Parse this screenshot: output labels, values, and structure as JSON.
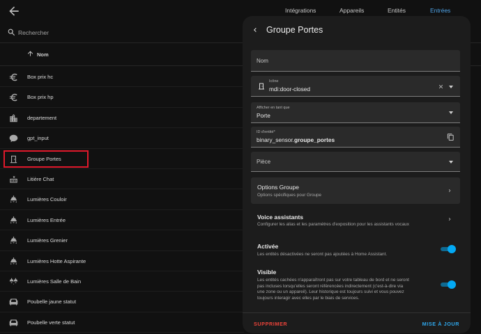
{
  "topbar": {
    "tabs": [
      {
        "label": "Intégrations"
      },
      {
        "label": "Appareils"
      },
      {
        "label": "Entités"
      },
      {
        "label": "Entrées",
        "active": true
      }
    ]
  },
  "search": {
    "placeholder": "Rechercher"
  },
  "table": {
    "column_header": "Nom",
    "rows": [
      {
        "label": "Box prix hc",
        "icon": "euro-icon"
      },
      {
        "label": "Box prix hp",
        "icon": "euro-icon"
      },
      {
        "label": "departement",
        "icon": "city-icon"
      },
      {
        "label": "gpt_input",
        "icon": "chat-bubble-icon"
      },
      {
        "label": "Groupe Portes",
        "icon": "door-closed-icon",
        "highlighted": true
      },
      {
        "label": "Litière Chat",
        "icon": "cat-litter-icon"
      },
      {
        "label": "Lumières Couloir",
        "icon": "ceiling-light-icon"
      },
      {
        "label": "Lumières Entrée",
        "icon": "ceiling-light-icon"
      },
      {
        "label": "Lumières Grenier",
        "icon": "ceiling-light-icon"
      },
      {
        "label": "Lumières Hotte Aspirante",
        "icon": "ceiling-light-icon"
      },
      {
        "label": "Lumières Salle de Bain",
        "icon": "ceiling-light-multiple-icon"
      },
      {
        "label": "Poubelle jaune statut",
        "icon": "sofa-icon"
      },
      {
        "label": "Poubelle verte statut",
        "icon": "sofa-icon"
      }
    ]
  },
  "dialog": {
    "title": "Groupe Portes",
    "name_field": {
      "label": "Nom",
      "value": ""
    },
    "icon_field": {
      "label": "Icône",
      "value": "mdi:door-closed"
    },
    "show_as_field": {
      "label": "Afficher en tant que",
      "value": "Porte"
    },
    "entity_id_field": {
      "label": "ID d'entité*",
      "prefix": "binary_sensor.",
      "suffix": "groupe_portes"
    },
    "room_field": {
      "label": "Pièce"
    },
    "group_options": {
      "title": "Options Groupe",
      "subtitle": "Options spécifiques pour Groupe"
    },
    "voice": {
      "title": "Voice assistants",
      "subtitle": "Configurer les alias et les paramètres d'exposition pour les assistants vocaux"
    },
    "enabled": {
      "title": "Activée",
      "description": "Les entités désactivées ne seront pas ajoutées à Home Assistant.",
      "on": true
    },
    "visible": {
      "title": "Visible",
      "description_lines": [
        "Les entités cachées n'apparaîtront pas sur votre tableau de bord et ne seront",
        "pas incluses lorsqu'elles seront référencées indirectement (c'est-à-dire via",
        "une zone ou un appareil). Leur historique est toujours suivi et vous pouvez",
        "toujours interagir avec elles par le biais de services."
      ],
      "on": true
    },
    "delete_label": "SUPPRIMER",
    "update_label": "MISE À JOUR"
  },
  "colors": {
    "accent": "#03a9f4",
    "danger": "#f0443a",
    "highlight": "#e0192b"
  }
}
